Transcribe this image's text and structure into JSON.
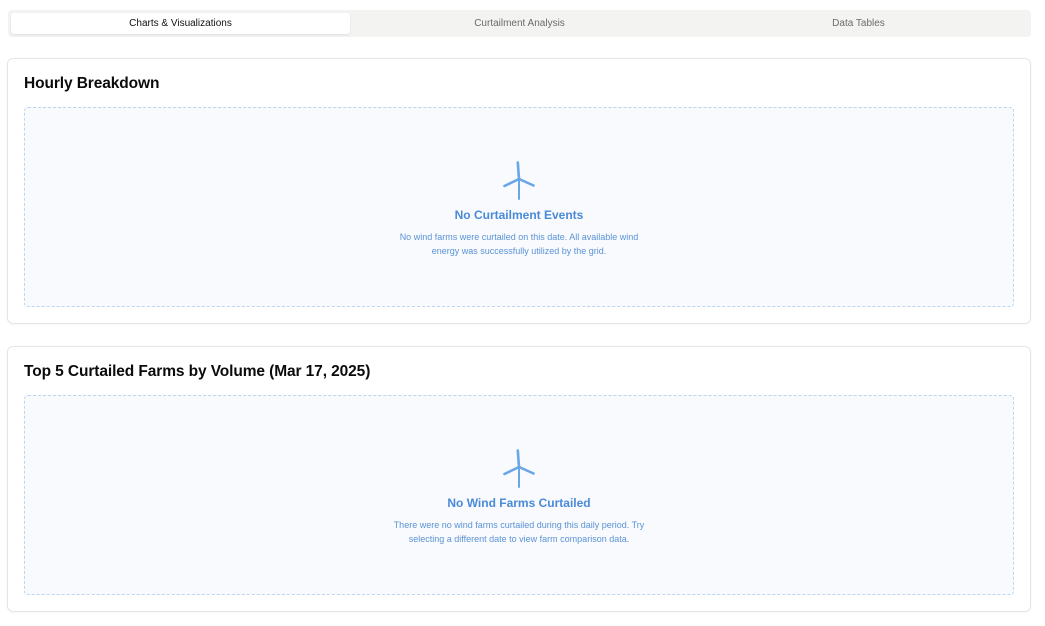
{
  "tabs": [
    {
      "label": "Charts & Visualizations",
      "active": true
    },
    {
      "label": "Curtailment Analysis",
      "active": false
    },
    {
      "label": "Data Tables",
      "active": false
    }
  ],
  "cards": {
    "hourly": {
      "title": "Hourly Breakdown",
      "empty_title": "No Curtailment Events",
      "empty_desc": "No wind farms were curtailed on this date. All available wind energy was successfully utilized by the grid."
    },
    "top_farms": {
      "title": "Top 5 Curtailed Farms by Volume (Mar 17, 2025)",
      "empty_title": "No Wind Farms Curtailed",
      "empty_desc": "There were no wind farms curtailed during this daily period. Try selecting a different date to view farm comparison data."
    }
  },
  "icons": {
    "empty_state": "wind-turbine-icon"
  },
  "colors": {
    "accent": "#4a8ad8",
    "icon": "#6aa6e6",
    "dashed_border": "#bcd6ef"
  }
}
